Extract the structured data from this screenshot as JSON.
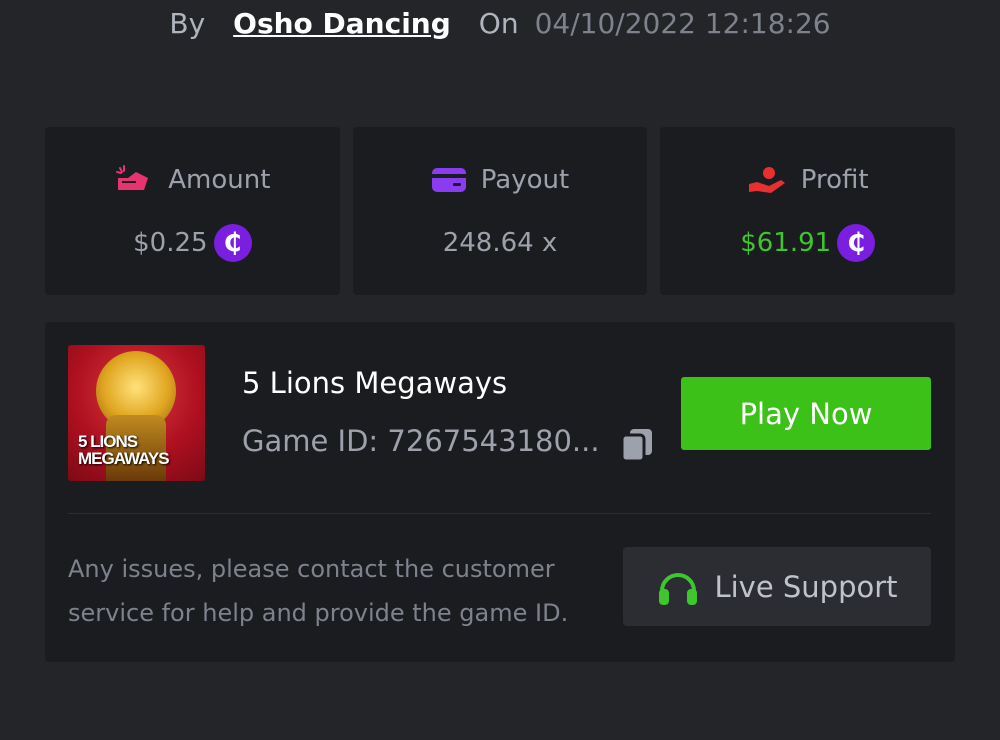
{
  "header": {
    "by_label": "By",
    "username": "Osho Dancing",
    "on_label": "On",
    "datetime": "04/10/2022 12:18:26"
  },
  "stats": {
    "amount": {
      "label": "Amount",
      "value": "$0.25",
      "icon": "amount-icon",
      "currency_icon": "coin-icon",
      "color": "#e8346e"
    },
    "payout": {
      "label": "Payout",
      "value": "248.64 x",
      "icon": "card-icon",
      "color": "#8a3cf0"
    },
    "profit": {
      "label": "Profit",
      "value": "$61.91",
      "icon": "hand-heart-icon",
      "currency_icon": "coin-icon",
      "color": "#e83030",
      "value_color": "#3fc62f"
    }
  },
  "currency": {
    "symbol": "₵",
    "color": "#7a1fe0"
  },
  "game": {
    "title": "5 Lions Megaways",
    "id_label": "Game ID: 7267543180...",
    "thumbnail_text_line1": "5 LIONS",
    "thumbnail_text_line2": "MEGAWAYS",
    "play_label": "Play Now"
  },
  "support": {
    "help_text": "Any issues, please contact the customer service for help and provide the game ID.",
    "button_label": "Live Support",
    "icon": "headset-icon"
  },
  "colors": {
    "accent_green": "#3bc117",
    "background": "#232529",
    "card": "#1b1c20"
  }
}
